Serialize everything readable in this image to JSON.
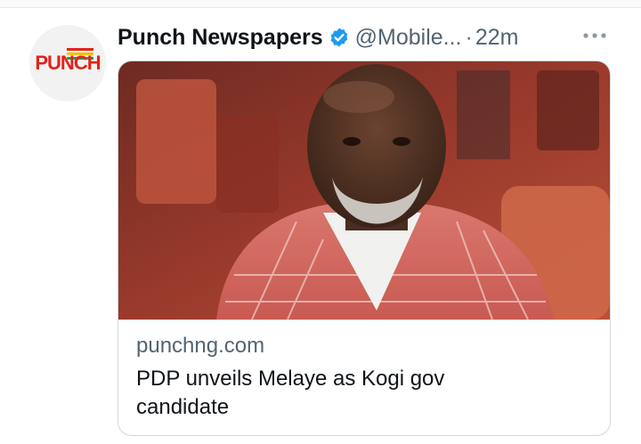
{
  "tweet": {
    "author_name": "Punch Newspapers",
    "handle": "@Mobile...",
    "separator": "·",
    "time": "22m",
    "verified_icon": "verified-badge-icon",
    "more_icon": "more-dots-icon",
    "avatar": {
      "logo_text": "PUNCH",
      "colors": {
        "red": "#e2241a",
        "yellow": "#f4c20d",
        "green": "#2e9e47"
      }
    }
  },
  "card": {
    "image_icon": "news-photo",
    "domain": "punchng.com",
    "headline": "PDP unveils Melaye as Kogi gov candidate"
  },
  "colors": {
    "verified": "#1d9bf0",
    "secondary_text": "#536471",
    "primary_text": "#0f1419",
    "border": "#cfd9de"
  }
}
